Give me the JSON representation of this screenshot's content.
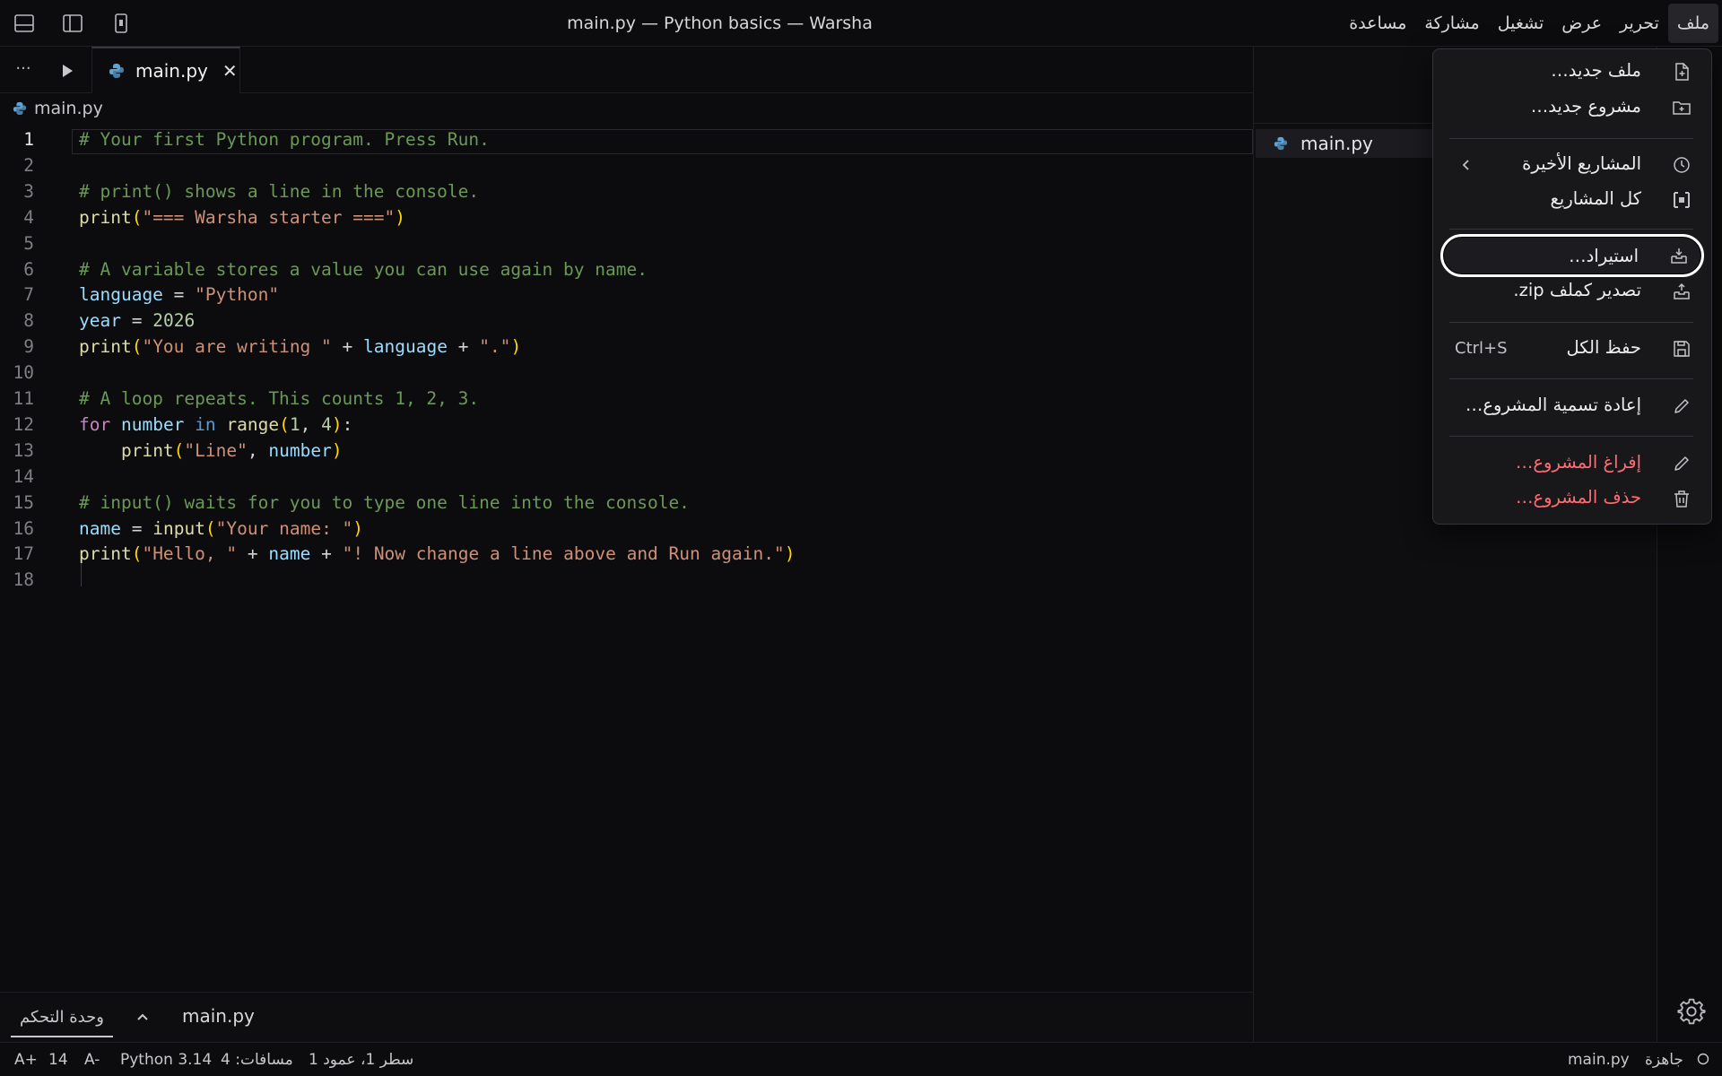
{
  "window": {
    "title": "main.py — Python basics — Warsha"
  },
  "menubar": [
    "ملف",
    "تحرير",
    "عرض",
    "تشغيل",
    "مشاركة",
    "مساعدة"
  ],
  "tab": {
    "label": "main.py",
    "close": "✕"
  },
  "breadcrumb": "main.py",
  "code_lines": [
    "# Your first Python program. Press Run.",
    "",
    "# print() shows a line in the console.",
    "print(\"=== Warsha starter ===\")",
    "",
    "# A variable stores a value you can use again by name.",
    "language = \"Python\"",
    "year = 2026",
    "print(\"You are writing \" + language + \".\")",
    "",
    "# A loop repeats. This counts 1, 2, 3.",
    "for number in range(1, 4):",
    "    print(\"Line\", number)",
    "",
    "# input() waits for you to type one line into the console.",
    "name = input(\"Your name: \")",
    "print(\"Hello, \" + name + \"! Now change a line above and Run again.\")",
    ""
  ],
  "line_numbers": [
    "1",
    "2",
    "3",
    "4",
    "5",
    "6",
    "7",
    "8",
    "9",
    "10",
    "11",
    "12",
    "13",
    "14",
    "15",
    "16",
    "17",
    "18"
  ],
  "panel": {
    "tab": "وحدة التحكم",
    "file": "main.py"
  },
  "sidebar": {
    "file": "main.py"
  },
  "file_menu": {
    "new_file": "ملف جديد…",
    "new_project": "مشروع جديد…",
    "recent_projects": "المشاريع الأخيرة",
    "all_projects": "كل المشاريع",
    "import": "استيراد…",
    "export_zip": "تصدير كملف zip.",
    "save_all": "حفظ الكل",
    "save_all_shortcut": "Ctrl+S",
    "rename_project": "إعادة تسمية المشروع…",
    "empty_project": "إفراغ المشروع…",
    "delete_project": "حذف المشروع…",
    "danger_color": "#ff6b72"
  },
  "statusbar": {
    "font_increase": "A+",
    "font_size": "14",
    "font_decrease": "A-",
    "language": "Python 3.14",
    "spaces": "مسافات: 4",
    "position": "سطر 1، عمود 1",
    "file": "main.py",
    "ready": "جاهزة"
  }
}
